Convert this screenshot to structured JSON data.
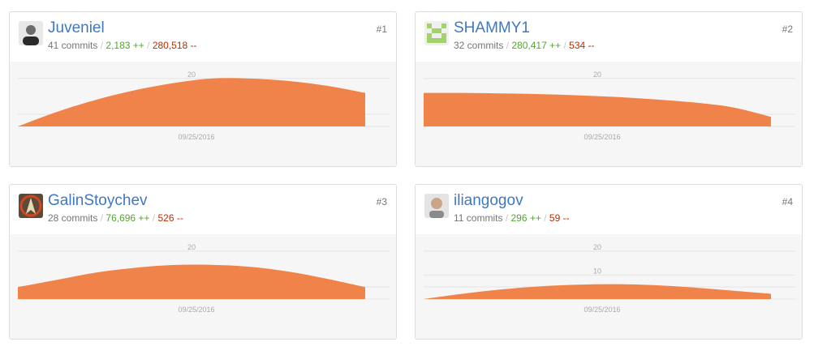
{
  "contributors": [
    {
      "username": "Juveniel",
      "commits": "41 commits",
      "additions": "2,183 ++",
      "deletions": "280,518 --",
      "rank": "#1",
      "avatar_icon": "user-photo-icon",
      "chart_data": {
        "type": "area",
        "x_label": "09/25/2016",
        "y_ticks": [
          "20"
        ],
        "y_tick_values": [
          20
        ],
        "ylim": [
          0,
          23
        ],
        "series": [
          {
            "values": [
              0,
              6,
              11,
              15,
              18,
              20,
              20,
              19,
              17,
              14
            ]
          }
        ],
        "color": "#f08349"
      }
    },
    {
      "username": "SHAMMY1",
      "commits": "32 commits",
      "additions": "280,417 ++",
      "deletions": "534 --",
      "rank": "#2",
      "avatar_icon": "pixel-identicon-icon",
      "chart_data": {
        "type": "area",
        "x_label": "09/25/2016",
        "y_ticks": [
          "20"
        ],
        "y_tick_values": [
          20
        ],
        "ylim": [
          0,
          23
        ],
        "series": [
          {
            "values": [
              14,
              14,
              13.8,
              13.5,
              13,
              12.3,
              11.3,
              10,
              8,
              4
            ]
          }
        ],
        "color": "#f08349"
      }
    },
    {
      "username": "GalinStoychev",
      "commits": "28 commits",
      "additions": "76,696 ++",
      "deletions": "526 --",
      "rank": "#3",
      "avatar_icon": "emblem-avatar-icon",
      "chart_data": {
        "type": "area",
        "x_label": "09/25/2016",
        "y_ticks": [
          "20"
        ],
        "y_tick_values": [
          20
        ],
        "ylim": [
          0,
          23
        ],
        "series": [
          {
            "values": [
              5,
              8,
              11,
              13,
              14.2,
              14.3,
              13.5,
              11.5,
              8.5,
              5
            ]
          }
        ],
        "color": "#f08349"
      }
    },
    {
      "username": "iliangogov",
      "commits": "11 commits",
      "additions": "296 ++",
      "deletions": "59 --",
      "rank": "#4",
      "avatar_icon": "user-photo-icon",
      "chart_data": {
        "type": "area",
        "x_label": "09/25/2016",
        "y_ticks": [
          "20",
          "10"
        ],
        "y_tick_values": [
          20,
          10
        ],
        "ylim": [
          0,
          23
        ],
        "series": [
          {
            "values": [
              0,
              2.2,
              4,
              5.3,
              6,
              6.2,
              5.8,
              4.8,
              3.5,
              2.2
            ]
          }
        ],
        "color": "#f08349"
      }
    }
  ],
  "separators": {
    "slash": "/"
  }
}
